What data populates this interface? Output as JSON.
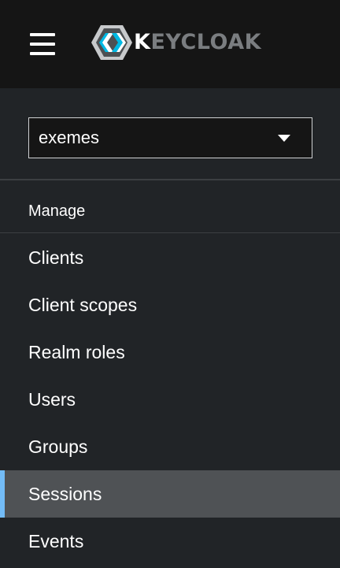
{
  "masthead": {
    "menu_icon": "hamburger-menu-icon",
    "brand": {
      "logo_icon": "keycloak-logo-icon",
      "text_first": "K",
      "text_rest": "EYCLOAK"
    }
  },
  "sidebar": {
    "realm_selector": {
      "value": "exemes",
      "icon": "caret-down-icon"
    },
    "section_title": "Manage",
    "items": [
      {
        "label": "Clients",
        "active": false
      },
      {
        "label": "Client scopes",
        "active": false
      },
      {
        "label": "Realm roles",
        "active": false
      },
      {
        "label": "Users",
        "active": false
      },
      {
        "label": "Groups",
        "active": false
      },
      {
        "label": "Sessions",
        "active": true
      },
      {
        "label": "Events",
        "active": false
      }
    ]
  },
  "colors": {
    "masthead_bg": "#151515",
    "sidebar_bg": "#212427",
    "active_item_bg": "#4f5255",
    "active_indicator": "#73bcf7",
    "logo_cyan": "#00b9e4",
    "logo_gray": "#7a7d80"
  }
}
